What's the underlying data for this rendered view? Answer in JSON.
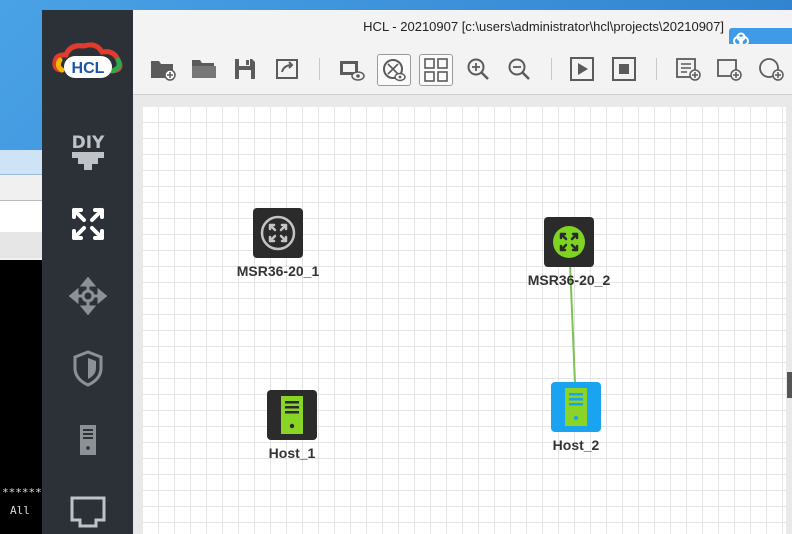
{
  "window": {
    "title": "HCL - 20210907 [c:\\users\\administrator\\hcl\\projects\\20210907]",
    "logo_text": "HCL"
  },
  "sidebar": {
    "items": [
      {
        "name": "diy",
        "label": "DIY",
        "icon": "diy-icon"
      },
      {
        "name": "routers",
        "icon": "router-icon"
      },
      {
        "name": "switches",
        "icon": "switch-icon"
      },
      {
        "name": "firewalls",
        "icon": "firewall-icon"
      },
      {
        "name": "terminals",
        "icon": "host-icon"
      },
      {
        "name": "connections",
        "icon": "port-icon"
      }
    ]
  },
  "toolbar": {
    "buttons": [
      "new-project-icon",
      "open-project-icon",
      "save-icon",
      "export-icon",
      "show-device-icon",
      "show-topology-icon",
      "grid-icon",
      "zoom-in-icon",
      "zoom-out-icon",
      "start-icon",
      "stop-icon",
      "add-list-icon",
      "add-rect-icon",
      "add-ellipse-icon"
    ]
  },
  "topology": {
    "devices": [
      {
        "label": "MSR36-20_1",
        "type": "router",
        "state": "stopped"
      },
      {
        "label": "MSR36-20_2",
        "type": "router",
        "state": "running"
      },
      {
        "label": "Host_1",
        "type": "host",
        "state": "stopped"
      },
      {
        "label": "Host_2",
        "type": "host",
        "state": "selected"
      }
    ],
    "links": [
      {
        "from": "MSR36-20_2",
        "to": "Host_2",
        "color": "#7cc44f"
      }
    ]
  },
  "background": {
    "terminal_line1": "******",
    "terminal_line2": "All"
  },
  "colors": {
    "sidebar_bg": "#2c3137",
    "router_running": "#7fd321",
    "host_selected_bg": "#1aa3f0",
    "host_screen": "#8ad425"
  }
}
